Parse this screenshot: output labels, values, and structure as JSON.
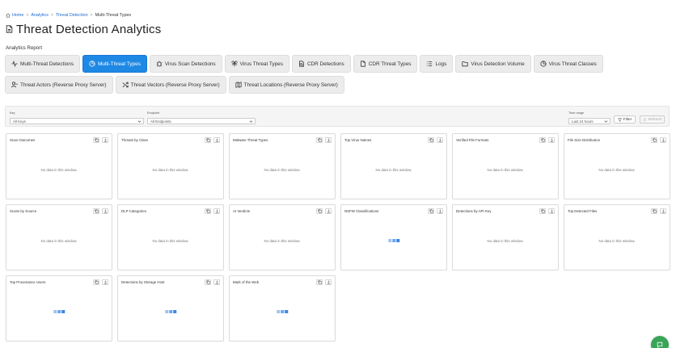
{
  "breadcrumb": {
    "home": "Home",
    "analytics": "Analytics",
    "threat_detection": "Threat Detection",
    "current": "Multi-Threat Types",
    "separator": ">"
  },
  "page": {
    "title": "Threat Detection Analytics",
    "section_label": "Analytics Report"
  },
  "tabs_row1": [
    {
      "label": "Multi-Threat Detections",
      "icon": "activity-icon",
      "active": false
    },
    {
      "label": "Multi-Threat Types",
      "icon": "pie-chart-icon",
      "active": true
    },
    {
      "label": "Virus Scan Detections",
      "icon": "bug-icon",
      "active": false
    },
    {
      "label": "Virus Threat Types",
      "icon": "biohazard-icon",
      "active": false
    },
    {
      "label": "CDR Detections",
      "icon": "file-scan-icon",
      "active": false
    },
    {
      "label": "CDR Threat Types",
      "icon": "file-icon",
      "active": false
    },
    {
      "label": "Logs",
      "icon": "list-icon",
      "active": false
    },
    {
      "label": "Virus Detection Volume",
      "icon": "folder-icon",
      "active": false
    },
    {
      "label": "Virus Threat Classes",
      "icon": "pie-chart-icon",
      "active": false
    }
  ],
  "tabs_row2": [
    {
      "label": "Threat Actors (Reverse Proxy Server)",
      "icon": "user-icon",
      "active": false
    },
    {
      "label": "Threat Vectors (Reverse Proxy Server)",
      "icon": "shuffle-icon",
      "active": false
    },
    {
      "label": "Threat Locations (Reverse Proxy Server)",
      "icon": "map-icon",
      "active": false
    }
  ],
  "filters": {
    "key_label": "Key",
    "key_value": "All Keys",
    "endpoint_label": "Endpoint",
    "endpoint_value": "All Endpoints",
    "time_label": "Time range",
    "time_value": "Last 24 hours",
    "filter_button": "Filter",
    "refresh_button": "Refresh"
  },
  "empty_text": "No data in this window.",
  "cards": [
    {
      "title": "Scan Outcomes",
      "state": "empty"
    },
    {
      "title": "Threats by Class",
      "state": "empty"
    },
    {
      "title": "Malware Threat Types",
      "state": "empty"
    },
    {
      "title": "Top Virus Names",
      "state": "empty"
    },
    {
      "title": "Verified File Formats",
      "state": "empty"
    },
    {
      "title": "File Size Distribution",
      "state": "empty"
    },
    {
      "title": "Scans by Source",
      "state": "empty"
    },
    {
      "title": "DLP Categories",
      "state": "empty"
    },
    {
      "title": "AI Verdicts",
      "state": "empty"
    },
    {
      "title": "NSFW Classifications",
      "state": "loading"
    },
    {
      "title": "Detections by API Key",
      "state": "empty"
    },
    {
      "title": "Top Detected Files",
      "state": "empty"
    },
    {
      "title": "Top Provenance Users",
      "state": "loading"
    },
    {
      "title": "Detections by Storage Host",
      "state": "loading"
    },
    {
      "title": "Mark of the Web",
      "state": "loading"
    }
  ],
  "colors": {
    "accent": "#1e88e5",
    "link": "#1b6ad1",
    "chat_button": "#3aa457"
  },
  "chat_icon": "chat-icon"
}
